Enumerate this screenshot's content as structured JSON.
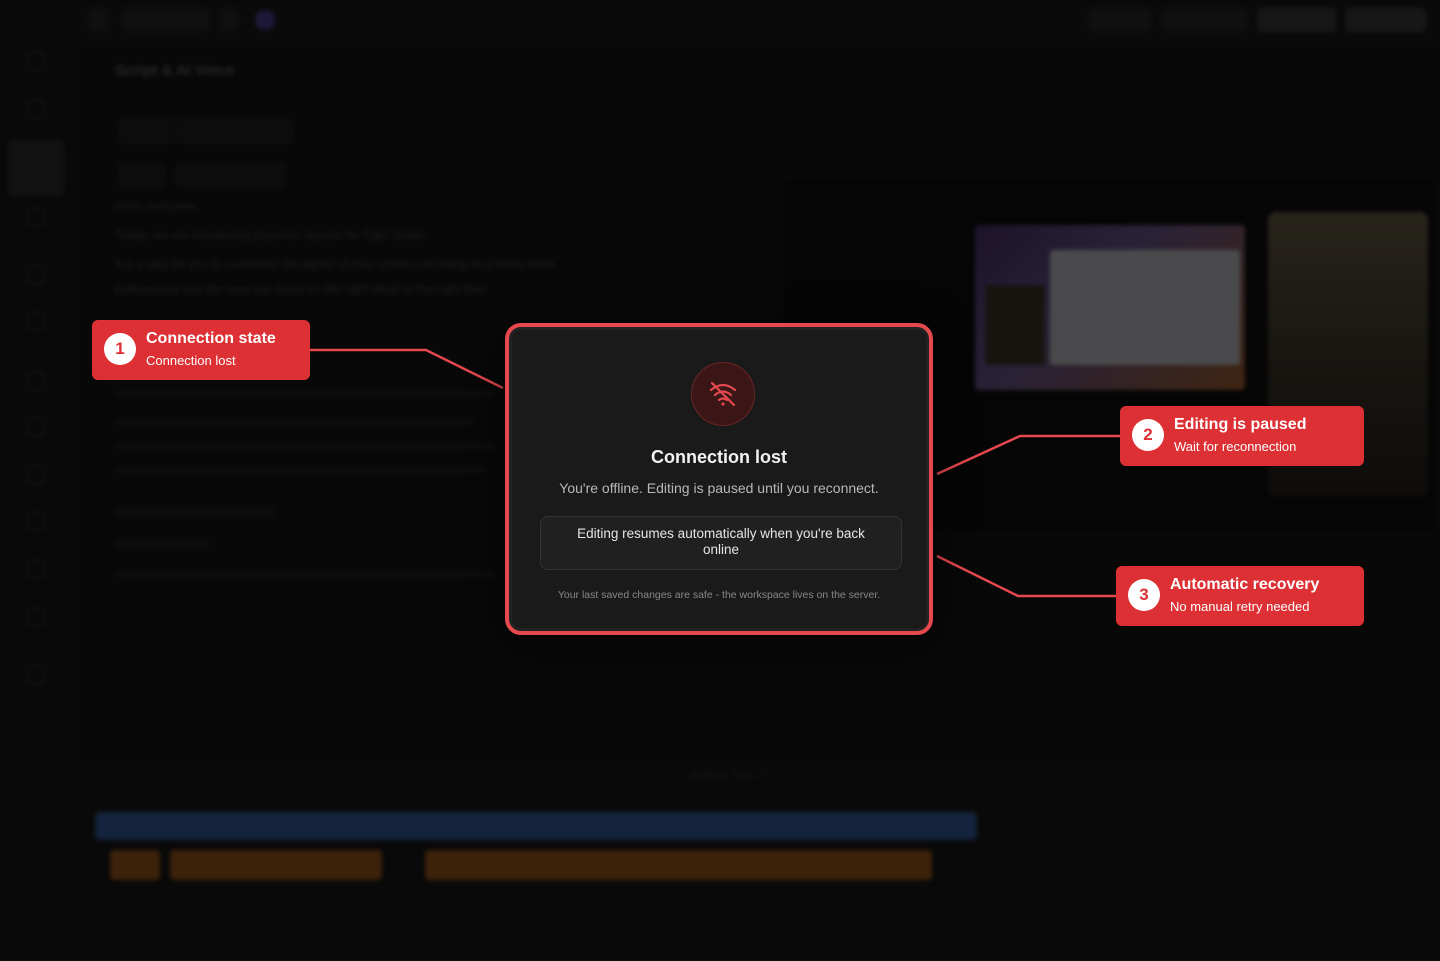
{
  "modal": {
    "title": "Connection lost",
    "subtitle": "You're offline. Editing is paused until you reconnect.",
    "info_box": "Editing resumes automatically when you're back online",
    "footnote": "Your last saved changes are safe - the workspace lives on the server.",
    "icon": "wifi-off-icon"
  },
  "callouts": [
    {
      "number": "1",
      "title": "Connection state",
      "subtitle": "Connection lost"
    },
    {
      "number": "2",
      "title": "Editing is paused",
      "subtitle": "Wait for reconnection"
    },
    {
      "number": "3",
      "title": "Automatic recovery",
      "subtitle": "No manual retry needed"
    }
  ],
  "background": {
    "script_heading": "Script & AI Voice",
    "script_lines": [
      "Hello everyone.",
      "Today, we are introducing Dynamic layouts for Tight Studio.",
      "It is a way for you to customize the layout of your screen recording so it looks more",
      "professional and the user can focus on the right detail at the right time."
    ],
    "timeline_label": "Editing \"Clip 1\""
  },
  "colors": {
    "accent": "#dc3034",
    "modal_border": "#e5484d",
    "modal_bg": "#1a1a1a"
  }
}
